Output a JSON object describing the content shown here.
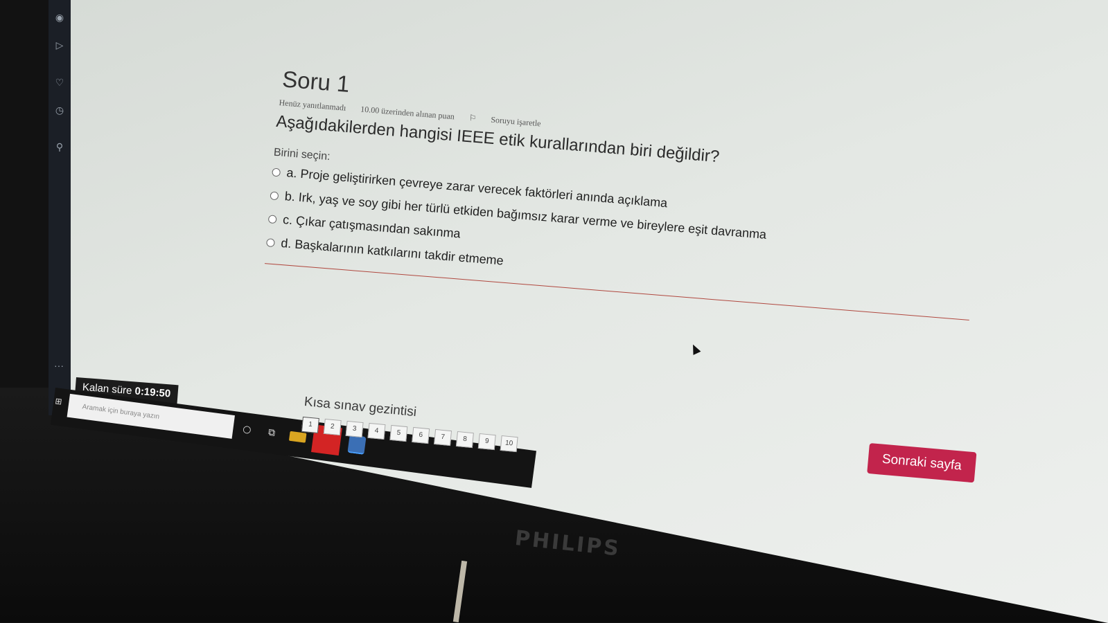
{
  "question": {
    "title": "Soru 1",
    "status": "Henüz yanıtlanmadı",
    "points": "10.00 üzerinden alınan puan",
    "flag_label": "Soruyu işaretle",
    "text": "Aşağıdakilerden hangisi IEEE etik kurallarından biri değildir?",
    "select_label": "Birini seçin:",
    "options": [
      "a. Proje geliştirirken çevreye zarar verecek faktörleri anında açıklama",
      "b. Irk, yaş ve soy gibi her türlü etkiden bağımsız karar verme ve bireylere eşit davranma",
      "c. Çıkar çatışmasından sakınma",
      "d. Başkalarının katkılarını takdir etmeme"
    ]
  },
  "timer": {
    "label": "Kalan süre",
    "value": "0:19:50"
  },
  "navigation": {
    "title": "Kısa sınav gezintisi",
    "pages": [
      "1",
      "2",
      "3",
      "4",
      "5",
      "6",
      "7",
      "8",
      "9",
      "10"
    ]
  },
  "next_button": "Sonraki sayfa",
  "taskbar": {
    "search_placeholder": "Aramak için buraya yazın"
  },
  "monitor_brand": "PHILIPS",
  "colors": {
    "accent": "#c2244c",
    "divider": "#b0473e"
  }
}
